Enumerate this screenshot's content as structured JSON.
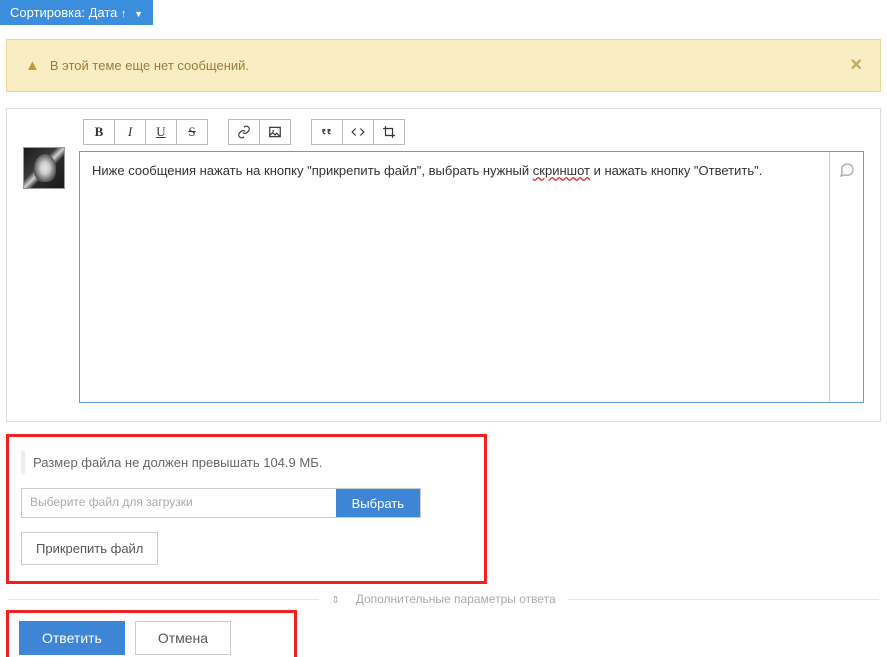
{
  "sort": {
    "label": "Сортировка:",
    "field": "Дата"
  },
  "alert": {
    "message": "В этой теме еще нет сообщений."
  },
  "editor": {
    "content_plain_pre": "Ниже сообщения нажать на кнопку \"прикрепить файл\", выбрать нужный ",
    "content_spelled": "скриншот",
    "content_plain_post": " и нажать кнопку \"Ответить\"."
  },
  "upload": {
    "size_note": "Размер файла не должен превышать 104.9 МБ.",
    "placeholder": "Выберите файл для загрузки",
    "select_label": "Выбрать",
    "attach_label": "Прикрепить файл"
  },
  "extra_params": "Дополнительные параметры ответа",
  "actions": {
    "submit": "Ответить",
    "cancel": "Отмена"
  },
  "colors": {
    "primary": "#3e85d6",
    "alert_bg": "#f9edc4",
    "highlight_border": "#e22"
  }
}
